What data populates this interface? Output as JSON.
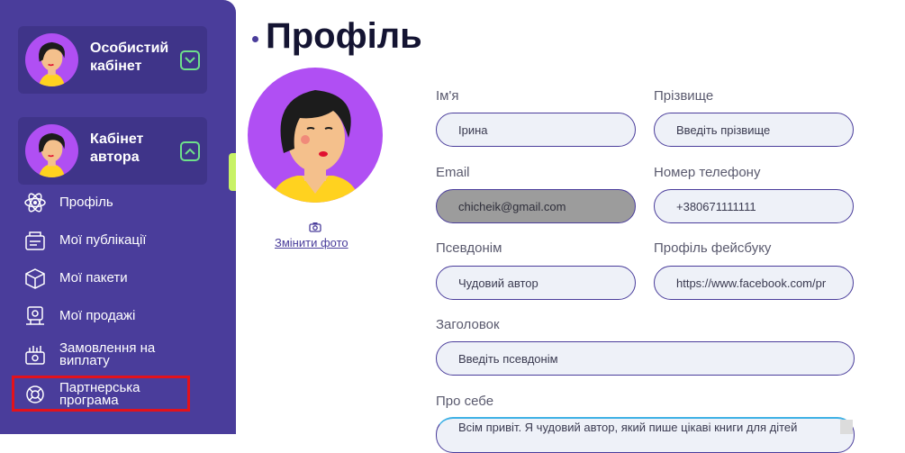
{
  "sidebar": {
    "cards": [
      {
        "title": "Особистий кабінет",
        "expanded": false
      },
      {
        "title": "Кабінет автора",
        "expanded": true
      }
    ],
    "items": [
      {
        "label": "Профіль",
        "icon": "atom-icon"
      },
      {
        "label": "Мої публікації",
        "icon": "publications-icon"
      },
      {
        "label": "Мої пакети",
        "icon": "package-icon"
      },
      {
        "label": "Мої продажі",
        "icon": "sales-icon"
      },
      {
        "label": "Замовлення на виплату",
        "icon": "payout-icon"
      },
      {
        "label": "Партнерська програма",
        "icon": "partner-icon"
      }
    ],
    "accent": "#4a3d9b"
  },
  "page": {
    "title": "Профіль",
    "change_photo": "Змінити фото"
  },
  "form": {
    "first_name": {
      "label": "Ім'я",
      "value": "Ірина"
    },
    "last_name": {
      "label": "Прізвище",
      "placeholder": "Введіть прізвище"
    },
    "email": {
      "label": "Email",
      "value": "chicheik@gmail.com"
    },
    "phone": {
      "label": "Номер телефону",
      "value": "+380671111111"
    },
    "pseudonym": {
      "label": "Псевдонім",
      "value": "Чудовий автор"
    },
    "facebook": {
      "label": "Профіль фейсбуку",
      "value": "https://www.facebook.com/pr"
    },
    "headline": {
      "label": "Заголовок",
      "placeholder": "Введіть псевдонім"
    },
    "about": {
      "label": "Про себе",
      "value": "Всім привіт. Я чудовий автор, який пише цікаві книги для дітей"
    }
  }
}
